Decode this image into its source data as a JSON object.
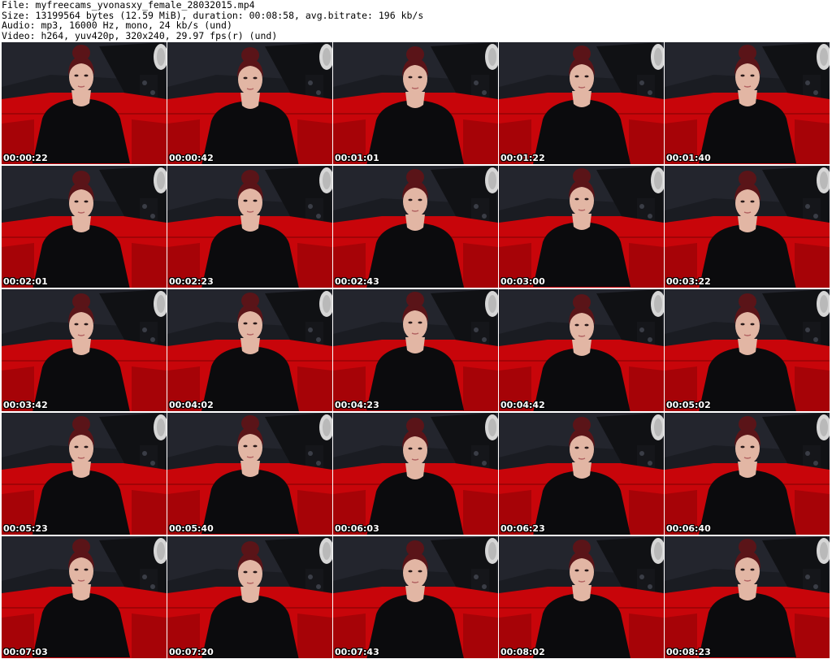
{
  "header": {
    "file_line": "File: myfreecams_yvonasxy_female_28032015.mp4",
    "size_line": "Size: 13199564 bytes (12.59 MiB), duration: 00:08:58, avg.bitrate: 196 kb/s",
    "audio_line": "Audio: mp3, 16000 Hz, mono, 24 kb/s (und)",
    "video_line": "Video: h264, yuv420p, 320x240, 29.97 fps(r) (und)"
  },
  "thumbnails": [
    {
      "time": "00:00:22"
    },
    {
      "time": "00:00:42"
    },
    {
      "time": "00:01:01"
    },
    {
      "time": "00:01:22"
    },
    {
      "time": "00:01:40"
    },
    {
      "time": "00:02:01"
    },
    {
      "time": "00:02:23"
    },
    {
      "time": "00:02:43"
    },
    {
      "time": "00:03:00"
    },
    {
      "time": "00:03:22"
    },
    {
      "time": "00:03:42"
    },
    {
      "time": "00:04:02"
    },
    {
      "time": "00:04:23"
    },
    {
      "time": "00:04:42"
    },
    {
      "time": "00:05:02"
    },
    {
      "time": "00:05:23"
    },
    {
      "time": "00:05:40"
    },
    {
      "time": "00:06:03"
    },
    {
      "time": "00:06:23"
    },
    {
      "time": "00:06:40"
    },
    {
      "time": "00:07:03"
    },
    {
      "time": "00:07:20"
    },
    {
      "time": "00:07:43"
    },
    {
      "time": "00:08:02"
    },
    {
      "time": "00:08:23"
    }
  ],
  "colors": {
    "background_wall": "#1a1c22",
    "sofa_red": "#c8050a",
    "sofa_dark_red": "#8a0205",
    "clothing_black": "#0b0b0d",
    "skin": "#e2b6a4",
    "hair": "#5a1418",
    "lamp_grey": "#d6d6d6",
    "timestamp_text": "#ffffff"
  }
}
